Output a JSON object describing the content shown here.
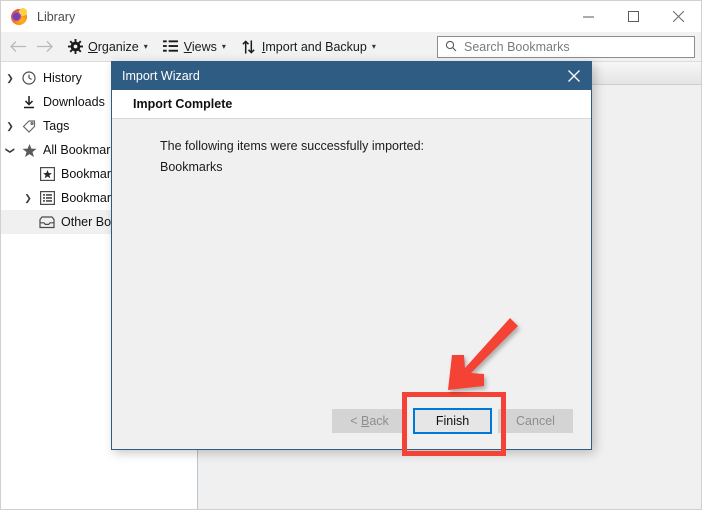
{
  "window": {
    "title": "Library",
    "logo_icon": "firefox-logo",
    "controls": {
      "minimize": "minimize-icon",
      "maximize": "maximize-icon",
      "close": "close-icon"
    }
  },
  "toolbar": {
    "back_icon": "arrow-left-icon",
    "forward_icon": "arrow-right-icon",
    "items": [
      {
        "label": "Organize",
        "accesskey": "O",
        "icon": "gear-icon",
        "has_caret": true
      },
      {
        "label": "Views",
        "accesskey": "V",
        "icon": "list-view-icon",
        "has_caret": true
      },
      {
        "label": "Import and Backup",
        "accesskey": "I",
        "icon": "import-export-icon",
        "has_caret": true
      }
    ],
    "caret_glyph": "▾"
  },
  "search": {
    "icon": "search-icon",
    "placeholder": "Search Bookmarks",
    "value": ""
  },
  "sidebar": {
    "items": [
      {
        "label": "History",
        "icon": "clock-icon",
        "twisty": "collapsed",
        "indent": 0,
        "selected": false
      },
      {
        "label": "Downloads",
        "icon": "download-icon",
        "twisty": "none",
        "indent": 0,
        "selected": false
      },
      {
        "label": "Tags",
        "icon": "tag-icon",
        "twisty": "collapsed",
        "indent": 0,
        "selected": false
      },
      {
        "label": "All Bookmark",
        "icon": "star-icon",
        "twisty": "expanded",
        "indent": 0,
        "selected": false
      },
      {
        "label": "Bookmark",
        "icon": "bookmarks-toolbar-icon",
        "twisty": "none",
        "indent": 1,
        "selected": false
      },
      {
        "label": "Bookmark",
        "icon": "bookmarks-menu-icon",
        "twisty": "collapsed",
        "indent": 1,
        "selected": false
      },
      {
        "label": "Other Boo",
        "icon": "other-bookmarks-icon",
        "twisty": "none",
        "indent": 1,
        "selected": true
      }
    ],
    "twisty_collapsed_glyph": "❯",
    "twisty_expanded_glyph": "❯"
  },
  "dialog": {
    "title": "Import Wizard",
    "close_icon": "close-icon",
    "header": "Import Complete",
    "body_lines": [
      "The following items were successfully imported:",
      "Bookmarks"
    ],
    "buttons": {
      "back": {
        "label": "< Back",
        "accesskey": "B",
        "state": "disabled"
      },
      "finish": {
        "label": "Finish",
        "state": "default-focused"
      },
      "cancel": {
        "label": "Cancel",
        "state": "disabled"
      }
    }
  },
  "annotations": {
    "highlight_color": "#f44336",
    "arrow_color": "#f44336",
    "focus_color": "#0078d7",
    "target": "Finish"
  }
}
